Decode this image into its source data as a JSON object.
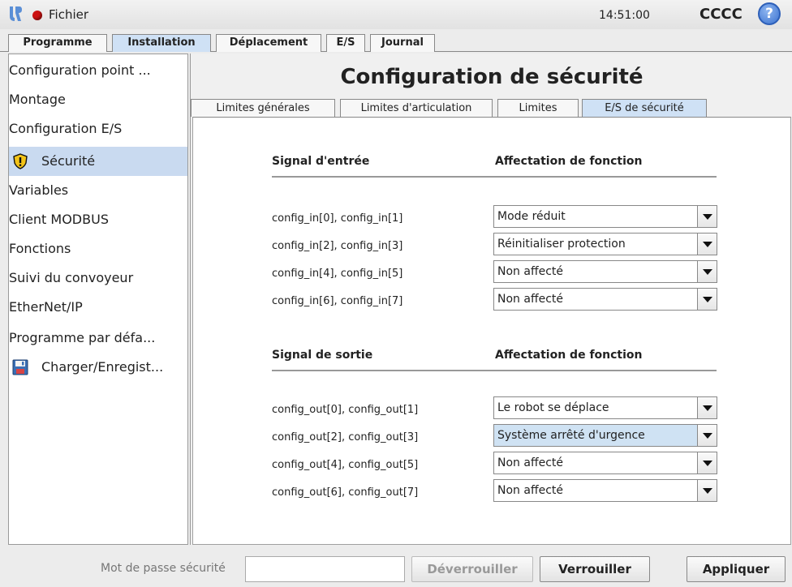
{
  "header": {
    "file_menu": "Fichier",
    "clock": "14:51:00",
    "robot_name": "CCCC",
    "help_symbol": "?"
  },
  "top_tabs": [
    {
      "label": "Programme",
      "active": false
    },
    {
      "label": "Installation",
      "active": true
    },
    {
      "label": "Déplacement",
      "active": false
    },
    {
      "label": "E/S",
      "active": false
    },
    {
      "label": "Journal",
      "active": false
    }
  ],
  "sidebar": {
    "items": [
      {
        "label": "Configuration point ..."
      },
      {
        "label": "Montage"
      },
      {
        "label": "Configuration E/S"
      },
      {
        "label": "Sécurité",
        "selected": true,
        "icon": "warning-shield-icon"
      },
      {
        "label": "Variables"
      },
      {
        "label": "Client MODBUS"
      },
      {
        "label": "Fonctions"
      },
      {
        "label": "Suivi du convoyeur"
      },
      {
        "label": "EtherNet/IP"
      },
      {
        "label": "Programme par défa..."
      },
      {
        "label": "Charger/Enregist...",
        "icon": "floppy-disk-icon"
      }
    ]
  },
  "main": {
    "title": "Configuration de sécurité",
    "tabs": [
      {
        "label": "Limites générales",
        "active": false
      },
      {
        "label": "Limites d'articulation",
        "active": false
      },
      {
        "label": "Limites",
        "active": false
      },
      {
        "label": "E/S de sécurité",
        "active": true
      }
    ],
    "inputs": {
      "header_signal": "Signal d'entrée",
      "header_function": "Affectation de fonction",
      "rows": [
        {
          "signal": "config_in[0], config_in[1]",
          "value": "Mode réduit"
        },
        {
          "signal": "config_in[2], config_in[3]",
          "value": "Réinitialiser protection"
        },
        {
          "signal": "config_in[4], config_in[5]",
          "value": "Non affecté"
        },
        {
          "signal": "config_in[6], config_in[7]",
          "value": "Non affecté"
        }
      ]
    },
    "outputs": {
      "header_signal": "Signal de sortie",
      "header_function": "Affectation de fonction",
      "rows": [
        {
          "signal": "config_out[0], config_out[1]",
          "value": "Le robot se déplace"
        },
        {
          "signal": "config_out[2], config_out[3]",
          "value": "Système arrêté d'urgence",
          "highlighted": true
        },
        {
          "signal": "config_out[4], config_out[5]",
          "value": "Non affecté"
        },
        {
          "signal": "config_out[6], config_out[7]",
          "value": "Non affecté"
        }
      ]
    }
  },
  "footer": {
    "password_label": "Mot de passe sécurité",
    "password_value": "",
    "unlock_label": "Déverrouiller",
    "lock_label": "Verrouiller",
    "apply_label": "Appliquer"
  },
  "colors": {
    "accent": "#cfe1f5",
    "selected": "#c9daf0",
    "status_red": "#cc1111",
    "help_blue": "#3a72d0"
  }
}
